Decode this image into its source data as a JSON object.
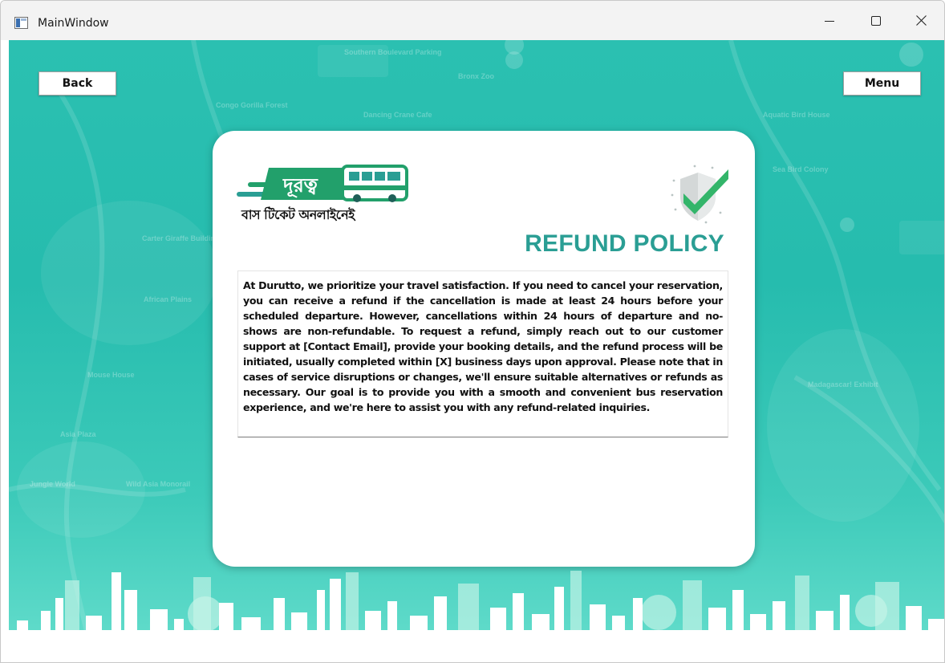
{
  "window": {
    "title": "MainWindow",
    "controls": {
      "minimize": "minimize-icon",
      "maximize": "maximize-icon",
      "close": "close-icon"
    }
  },
  "nav": {
    "back_label": "Back",
    "menu_label": "Menu"
  },
  "brand": {
    "logo_text": "দূরত্ব",
    "caption": "বাস টিকেট অনলাইনেই",
    "colors": {
      "green": "#22a06b",
      "teal": "#2a9e94",
      "background": "#2bc0b1"
    }
  },
  "policy": {
    "title": "REFUND POLICY",
    "body": "At Durutto, we prioritize your travel satisfaction. If you need to cancel your reservation, you can receive a refund if the cancellation is made at least 24 hours before your scheduled departure. However, cancellations within 24 hours of departure and no-shows are non-refundable. To request a refund, simply reach out to our customer support at [Contact Email], provide your booking details, and the refund process will be initiated, usually completed within [X] business days upon approval. Please note that in cases of service disruptions or changes, we'll ensure suitable alternatives or refunds as necessary. Our goal is to provide you with a smooth and convenient bus reservation experience, and we're here to assist you with any refund-related inquiries."
  },
  "map_labels": [
    "Southern Boulevard Parking",
    "Congo Gorilla Forest",
    "Dancing Crane Cafe",
    "Bronx Zoo",
    "Carter Giraffe Building",
    "African Plains",
    "Mouse House",
    "Asia Plaza",
    "Jungle World",
    "Wild Asia Monorail",
    "Aquatic Bird House",
    "Sea Bird Colony",
    "Madagascar! Exhibit"
  ]
}
